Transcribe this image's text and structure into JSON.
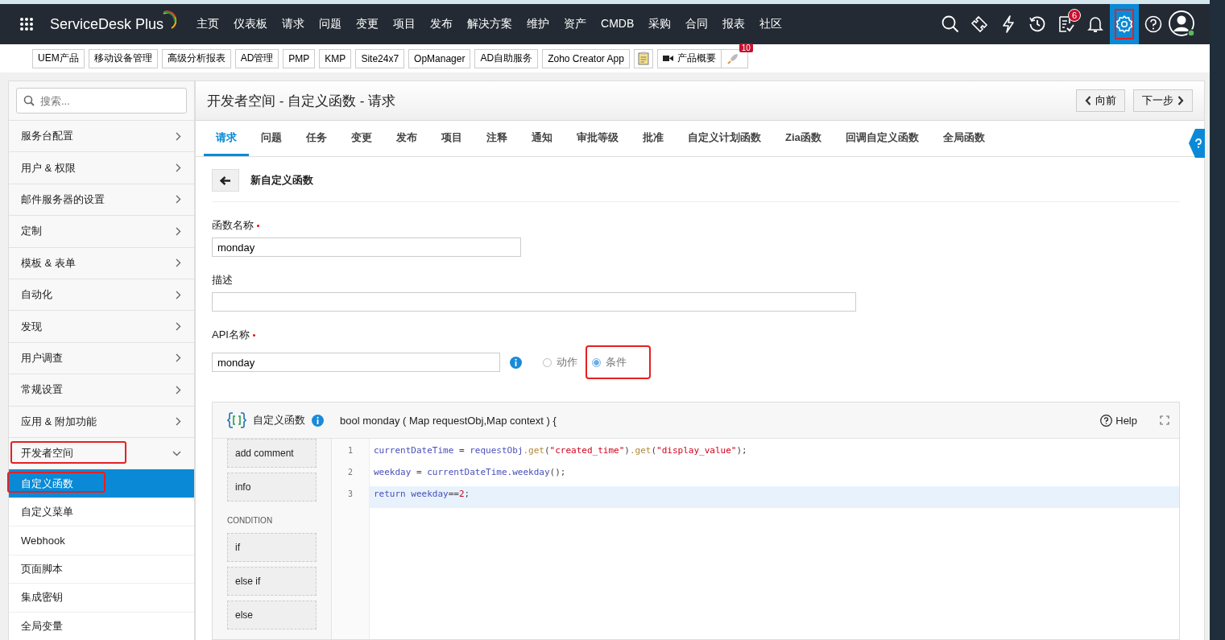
{
  "topbar": {
    "product": "ServiceDesk Plus",
    "nav": [
      "主页",
      "仪表板",
      "请求",
      "问题",
      "变更",
      "项目",
      "发布",
      "解决方案",
      "维护",
      "资产",
      "CMDB",
      "采购",
      "合同",
      "报表",
      "社区"
    ],
    "tools": [
      {
        "kind": "search",
        "selected": false,
        "annotated": false
      },
      {
        "kind": "ticket",
        "selected": false,
        "annotated": false
      },
      {
        "kind": "bolt",
        "selected": false,
        "annotated": false
      },
      {
        "kind": "history",
        "selected": false,
        "annotated": false
      },
      {
        "kind": "tasks",
        "badge": "6",
        "selected": false,
        "annotated": false
      },
      {
        "kind": "bell",
        "selected": false,
        "annotated": false
      },
      {
        "kind": "gear",
        "selected": true,
        "annotated": true
      },
      {
        "kind": "help",
        "selected": false,
        "annotated": false
      },
      {
        "kind": "avatar",
        "selected": false,
        "annotated": false
      }
    ]
  },
  "quicklinks": [
    {
      "kind": "text",
      "label": "UEM产品"
    },
    {
      "kind": "text",
      "label": "移动设备管理"
    },
    {
      "kind": "text",
      "label": "高级分析报表"
    },
    {
      "kind": "text",
      "label": "AD管理"
    },
    {
      "kind": "text",
      "label": "PMP"
    },
    {
      "kind": "text",
      "label": "KMP"
    },
    {
      "kind": "text",
      "label": "Site24x7"
    },
    {
      "kind": "text",
      "label": "OpManager"
    },
    {
      "kind": "text",
      "label": "AD自助服务"
    },
    {
      "kind": "text",
      "label": "Zoho Creator App"
    },
    {
      "kind": "clipboard"
    },
    {
      "kind": "video",
      "label": "产品概要"
    },
    {
      "kind": "rocket",
      "badge": "10"
    }
  ],
  "sidebar": {
    "search": {
      "placeholder": "搜索..."
    },
    "items": [
      {
        "label": "服务台配置",
        "expanded": false,
        "annotated": false
      },
      {
        "label": "用户 & 权限",
        "expanded": false,
        "annotated": false
      },
      {
        "label": "邮件服务器的设置",
        "expanded": false,
        "annotated": false
      },
      {
        "label": "定制",
        "expanded": false,
        "annotated": false
      },
      {
        "label": "模板 & 表单",
        "expanded": false,
        "annotated": false
      },
      {
        "label": "自动化",
        "expanded": false,
        "annotated": false
      },
      {
        "label": "发现",
        "expanded": false,
        "annotated": false
      },
      {
        "label": "用户调查",
        "expanded": false,
        "annotated": false
      },
      {
        "label": "常规设置",
        "expanded": false,
        "annotated": false
      },
      {
        "label": "应用 & 附加功能",
        "expanded": false,
        "annotated": false
      },
      {
        "label": "开发者空间",
        "expanded": true,
        "annotated": true,
        "children": [
          {
            "label": "自定义函数",
            "selected": true,
            "annotated": true
          },
          {
            "label": "自定义菜单",
            "selected": false,
            "annotated": false
          },
          {
            "label": "Webhook",
            "selected": false,
            "annotated": false
          },
          {
            "label": "页面脚本",
            "selected": false,
            "annotated": false
          },
          {
            "label": "集成密钥",
            "selected": false,
            "annotated": false
          },
          {
            "label": "全局变量",
            "selected": false,
            "annotated": false
          }
        ]
      }
    ]
  },
  "page": {
    "title": "开发者空间 - 自定义函数 - 请求",
    "prev_button": "向前",
    "next_button": "下一步",
    "tabs": [
      {
        "label": "请求",
        "selected": true
      },
      {
        "label": "问题",
        "selected": false
      },
      {
        "label": "任务",
        "selected": false
      },
      {
        "label": "变更",
        "selected": false
      },
      {
        "label": "发布",
        "selected": false
      },
      {
        "label": "项目",
        "selected": false
      },
      {
        "label": "注释",
        "selected": false
      },
      {
        "label": "通知",
        "selected": false
      },
      {
        "label": "审批等级",
        "selected": false
      },
      {
        "label": "批准",
        "selected": false
      },
      {
        "label": "自定义计划函数",
        "selected": false
      },
      {
        "label": "Zia函数",
        "selected": false
      },
      {
        "label": "回调自定义函数",
        "selected": false
      },
      {
        "label": "全局函数",
        "selected": false
      }
    ],
    "form_title": "新自定义函数",
    "function_name": {
      "label": "函数名称",
      "required": true,
      "value": "monday"
    },
    "description": {
      "label": "描述"
    },
    "api_name": {
      "label": "API名称",
      "required": true,
      "value": "monday"
    },
    "type_options": [
      {
        "label": "动作",
        "selected": false,
        "annotated": false
      },
      {
        "label": "条件",
        "selected": true,
        "annotated": true
      }
    ],
    "editor": {
      "title": "自定义函数",
      "signature": "bool monday ( Map requestObj,Map context ) {",
      "help": "Help",
      "palette": [
        {
          "kind": "snippet",
          "label": "add comment"
        },
        {
          "kind": "snippet",
          "label": "info"
        },
        {
          "kind": "heading",
          "label": "CONDITION"
        },
        {
          "kind": "snippet",
          "label": "if"
        },
        {
          "kind": "snippet",
          "label": "else if"
        },
        {
          "kind": "snippet",
          "label": "else"
        }
      ],
      "lines": [
        {
          "number": "1",
          "current": false,
          "tokens": [
            {
              "kind": "var",
              "text": "currentDateTime"
            },
            {
              "kind": "op",
              "text": " = "
            },
            {
              "kind": "var",
              "text": "requestObj"
            },
            {
              "kind": "method",
              "text": ".get"
            },
            {
              "kind": "op",
              "text": "("
            },
            {
              "kind": "str",
              "text": "\"created_time\""
            },
            {
              "kind": "op",
              "text": ")"
            },
            {
              "kind": "method",
              "text": ".get"
            },
            {
              "kind": "op",
              "text": "("
            },
            {
              "kind": "str",
              "text": "\"display_value\""
            },
            {
              "kind": "op",
              "text": ");"
            }
          ]
        },
        {
          "number": "2",
          "current": false,
          "tokens": [
            {
              "kind": "var",
              "text": "weekday"
            },
            {
              "kind": "op",
              "text": " = "
            },
            {
              "kind": "var",
              "text": "currentDateTime.weekday"
            },
            {
              "kind": "op",
              "text": "();"
            }
          ]
        },
        {
          "number": "3",
          "current": true,
          "tokens": [
            {
              "kind": "var",
              "text": "return weekday"
            },
            {
              "kind": "op",
              "text": "=="
            },
            {
              "kind": "str",
              "text": "2"
            },
            {
              "kind": "op",
              "text": ";"
            }
          ]
        }
      ]
    }
  }
}
